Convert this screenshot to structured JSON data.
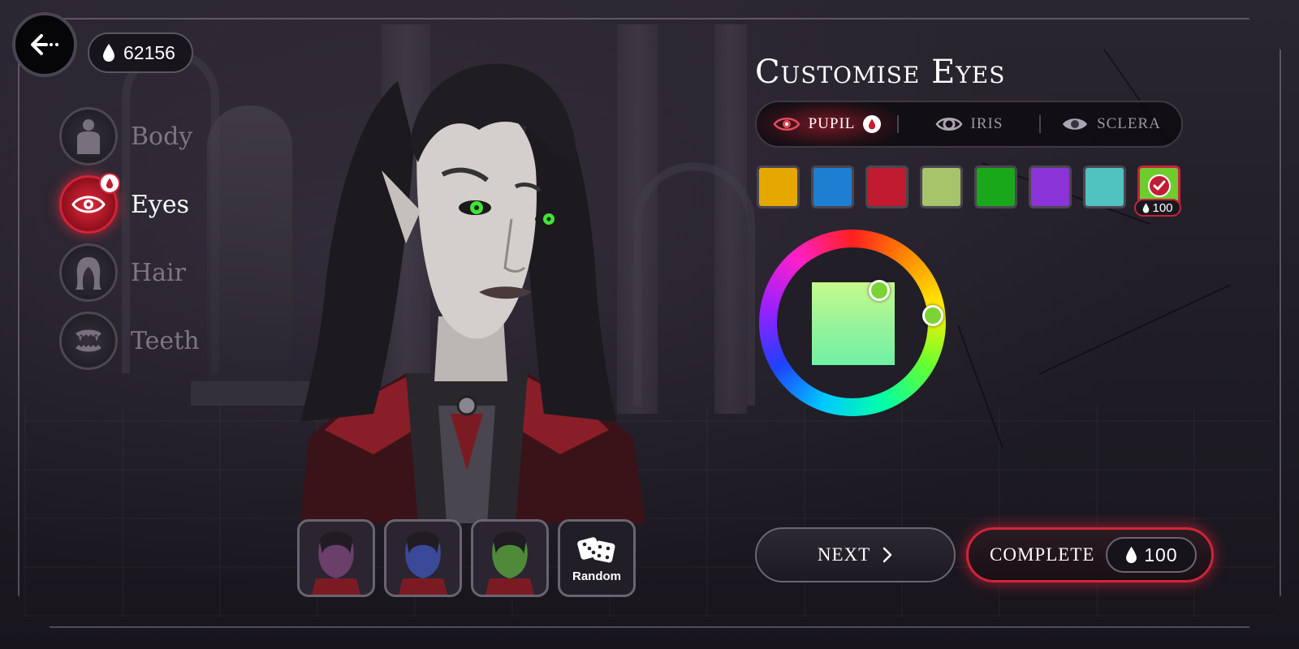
{
  "currency": {
    "amount": "62156",
    "icon": "blood-drop-icon"
  },
  "nav": {
    "items": [
      {
        "label": "Body",
        "icon": "body-icon",
        "active": false
      },
      {
        "label": "Eyes",
        "icon": "eye-icon",
        "active": true
      },
      {
        "label": "Hair",
        "icon": "hair-icon",
        "active": false
      },
      {
        "label": "Teeth",
        "icon": "teeth-icon",
        "active": false
      }
    ]
  },
  "panel": {
    "title": "Customise Eyes",
    "tabs": [
      {
        "label": "PUPIL",
        "active": true
      },
      {
        "label": "IRIS",
        "active": false
      },
      {
        "label": "SCLERA",
        "active": false
      }
    ],
    "swatches": [
      "#e6a800",
      "#1e7fd0",
      "#c01b30",
      "#a6c46a",
      "#18a81a",
      "#8a33d6",
      "#50c3c0",
      "#6fcc2f"
    ],
    "selected_swatch_cost": "100",
    "color_picker": {
      "selected_color": "#7cd334"
    }
  },
  "presets": {
    "skin_tones": [
      "#6a3f6a",
      "#3a4a98",
      "#4f8a3a"
    ],
    "random_label": "Random"
  },
  "buttons": {
    "next_label": "NEXT",
    "complete_label": "COMPLETE",
    "complete_cost": "100"
  },
  "colors": {
    "accent_red": "#d2233a",
    "background": "#1f1c25"
  }
}
